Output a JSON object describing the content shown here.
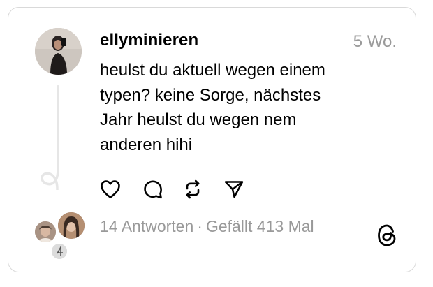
{
  "post": {
    "username": "ellyminieren",
    "timestamp": "5 Wo.",
    "text_lines": [
      "heulst du aktuell wegen einem",
      "typen? keine Sorge, nächstes",
      "Jahr heulst du wegen nem",
      "anderen hihi"
    ],
    "replies": "14 Antworten",
    "separator": "·",
    "likes": "Gefällt 413 Mal"
  },
  "actions": [
    {
      "name": "like",
      "icon": "heart-icon"
    },
    {
      "name": "reply",
      "icon": "comment-icon"
    },
    {
      "name": "repost",
      "icon": "repost-icon"
    },
    {
      "name": "share",
      "icon": "send-icon"
    }
  ],
  "branding": {
    "icon": "threads-logo-icon"
  },
  "colors": {
    "text": "#000000",
    "muted": "#999999",
    "border": "#d9d9d9",
    "thread_line": "#e6e6e6"
  }
}
